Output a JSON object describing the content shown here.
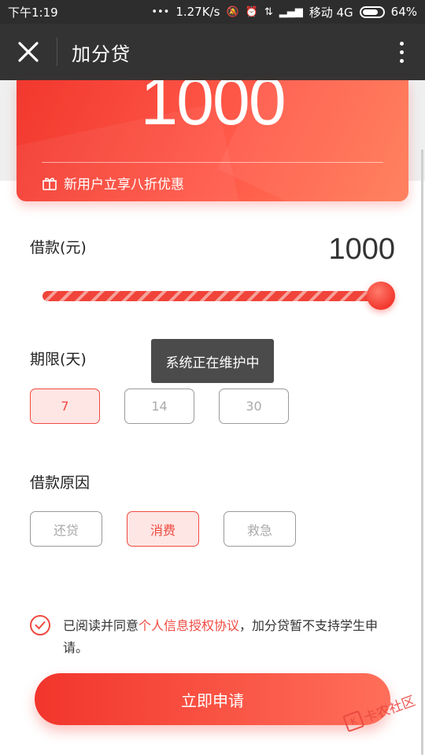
{
  "status_bar": {
    "time": "下午1:19",
    "speed": "1.27K/s",
    "carrier": "移动 4G",
    "battery": "64%",
    "battery_level": 0.64
  },
  "header": {
    "title": "加分贷",
    "close_icon": "close-icon",
    "more_icon": "more-vertical-icon"
  },
  "card": {
    "amount": "1000",
    "promo": "新用户立享八折优惠",
    "promo_icon": "gift-icon"
  },
  "borrow": {
    "label": "借款(元)",
    "value": "1000",
    "slider_fraction": 1.0
  },
  "term": {
    "label": "期限(天)",
    "options": [
      "7",
      "14",
      "30"
    ],
    "selected": "7"
  },
  "toast": "系统正在维护中",
  "reason": {
    "label": "借款原因",
    "options": [
      "还贷",
      "消费",
      "救急"
    ],
    "selected": "消费"
  },
  "agreement": {
    "prefix": "已阅读并同意",
    "link": "个人信息授权协议",
    "suffix": "，加分贷暂不支持学生申请。",
    "checked": true
  },
  "submit_label": "立即申请",
  "watermark": "卡农社区",
  "colors": {
    "accent": "#ef4a40",
    "header_bg": "#333333"
  }
}
